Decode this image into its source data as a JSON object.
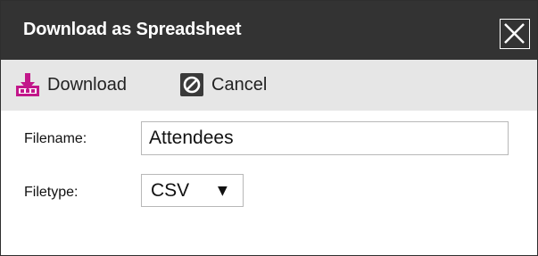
{
  "dialog": {
    "title": "Download as Spreadsheet",
    "close_icon": "close-icon"
  },
  "toolbar": {
    "download_label": "Download",
    "download_icon": "download-icon",
    "cancel_label": "Cancel",
    "cancel_icon": "cancel-icon"
  },
  "form": {
    "filename_label": "Filename:",
    "filename_value": "Attendees",
    "filetype_label": "Filetype:",
    "filetype_value": "CSV",
    "dropdown_icon": "dropdown-arrow-icon"
  },
  "colors": {
    "titlebar": "#333333",
    "toolbar": "#e6e6e6",
    "download_icon": "#c2178a"
  }
}
